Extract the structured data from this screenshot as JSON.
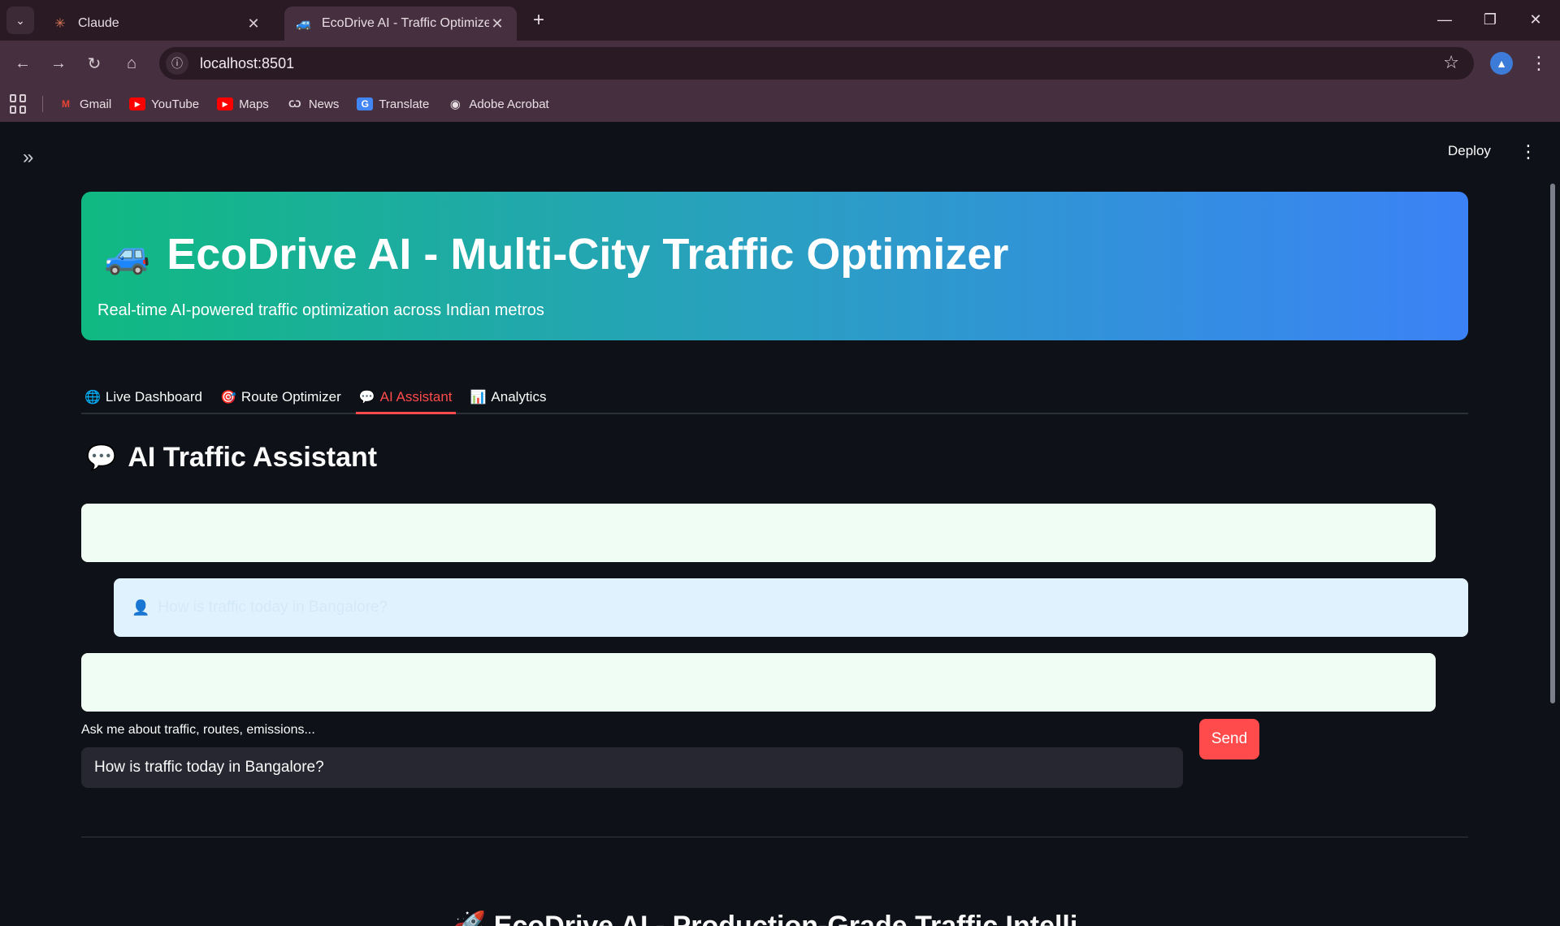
{
  "browser": {
    "tabs": [
      {
        "title": "Claude",
        "icon": "claude-icon"
      },
      {
        "title": "EcoDrive AI - Traffic Optimizer",
        "icon": "car-icon",
        "active": true
      }
    ],
    "url": "localhost:8501",
    "bookmarks": [
      {
        "label": "Gmail",
        "icon": "gmail-icon"
      },
      {
        "label": "YouTube",
        "icon": "youtube-icon"
      },
      {
        "label": "Maps",
        "icon": "maps-icon"
      },
      {
        "label": "News",
        "icon": "news-icon"
      },
      {
        "label": "Translate",
        "icon": "translate-icon"
      },
      {
        "label": "Adobe Acrobat",
        "icon": "acrobat-icon"
      }
    ]
  },
  "app": {
    "deploy_label": "Deploy",
    "hero": {
      "title": "EcoDrive AI - Multi-City Traffic Optimizer",
      "subtitle": "Real-time AI-powered traffic optimization across Indian metros",
      "gradient": [
        "#10b981",
        "#3b82f6"
      ]
    },
    "tabs": [
      {
        "label": "Live Dashboard",
        "icon": "globe-icon"
      },
      {
        "label": "Route Optimizer",
        "icon": "target-icon"
      },
      {
        "label": "AI Assistant",
        "icon": "speech-bubble-icon",
        "active": true
      },
      {
        "label": "Analytics",
        "icon": "bar-chart-icon"
      }
    ],
    "section_title": "AI Traffic Assistant",
    "messages": [
      {
        "role": "assistant",
        "text": ""
      },
      {
        "role": "user",
        "text": "How is traffic today in Bangalore?"
      },
      {
        "role": "assistant",
        "text": ""
      }
    ],
    "input": {
      "label": "Ask me about traffic, routes, emissions...",
      "value": "How is traffic today in Bangalore?"
    },
    "send_label": "Send",
    "footer_title": "EcoDrive AI - Production-Grade Traffic Intelli",
    "accent_color": "#ff4b4b"
  }
}
